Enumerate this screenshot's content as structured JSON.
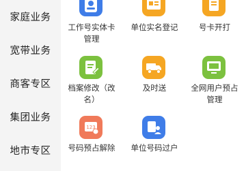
{
  "sidebar": {
    "items": [
      {
        "label": "家庭业务"
      },
      {
        "label": "宽带业务"
      },
      {
        "label": "商客专区"
      },
      {
        "label": "集团业务"
      },
      {
        "label": "地市专区"
      }
    ]
  },
  "main": {
    "rows": [
      [
        {
          "label_lines": [
            "工作号实体卡",
            "管理"
          ],
          "icon": "id-card-icon",
          "color": "#3f7de8"
        },
        {
          "label_lines": [
            "单位实名登记"
          ],
          "icon": "registration-card-icon",
          "color": "#f5a623"
        },
        {
          "label_lines": [
            "号卡开打"
          ],
          "icon": "document-icon",
          "color": "#f5a623"
        }
      ],
      [
        {
          "label_lines": [
            "档案修改（改",
            "名）"
          ],
          "icon": "edit-file-icon",
          "color": "#7cc13f"
        },
        {
          "label_lines": [
            "及时送"
          ],
          "icon": "truck-icon",
          "color": "#f5a623"
        },
        {
          "label_lines": [
            "全网用户预占",
            "管理"
          ],
          "icon": "monitor-icon",
          "color": "#7cc13f"
        }
      ],
      [
        {
          "label_lines": [
            "号码预占解除"
          ],
          "icon": "unlock-number-icon",
          "color": "#f07a5a"
        },
        {
          "label_lines": [
            "单位号码过户"
          ],
          "icon": "transfer-icon",
          "color": "#3f7de8"
        }
      ]
    ]
  }
}
